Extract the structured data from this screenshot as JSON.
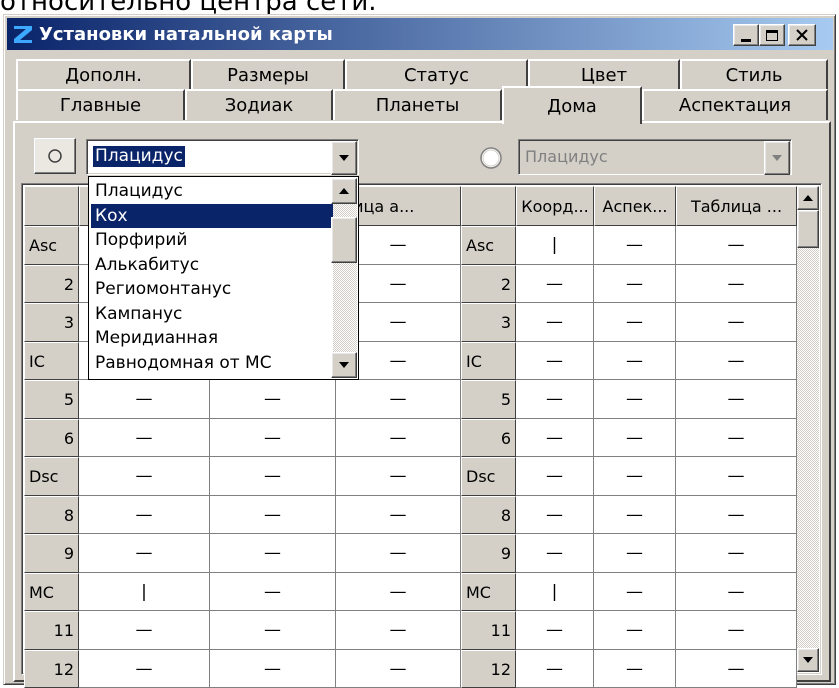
{
  "background_text": "относительно центра сети.",
  "window": {
    "title": "Установки натальной карты",
    "title_bar_color": "#0a246a",
    "title_bar_gradient_end": "#a6caf0",
    "face_color": "#d4d0c8",
    "selection_color": "#0a246a"
  },
  "tabs": {
    "row_back": [
      "Дополн.",
      "Размеры",
      "Статус",
      "Цвет",
      "Стиль"
    ],
    "row_front": [
      "Главные",
      "Зодиак",
      "Планеты",
      "Дома",
      "Аспектация"
    ],
    "active": "Дома"
  },
  "left_panel": {
    "house_system_value": "Плацидус",
    "column_headers": [
      "",
      "",
      "",
      "блица а..."
    ],
    "dropdown_options": [
      "Плацидус",
      "Кох",
      "Порфирий",
      "Алькабитус",
      "Региомонтанус",
      "Кампанус",
      "Меридианная",
      "Равнодомная от МС"
    ],
    "highlighted_option": "Кох"
  },
  "right_panel": {
    "house_system_value": "Плацидус",
    "column_headers": [
      "",
      "Коорд...",
      "Аспек...",
      "Таблица ..."
    ]
  },
  "rows": [
    {
      "house": "Asc",
      "left": [
        "",
        "—",
        "—"
      ],
      "right": [
        "|",
        "—",
        "—"
      ]
    },
    {
      "house": "2",
      "left": [
        "",
        "—",
        "—"
      ],
      "right": [
        "—",
        "—",
        "—"
      ]
    },
    {
      "house": "3",
      "left": [
        "",
        "—",
        "—"
      ],
      "right": [
        "—",
        "—",
        "—"
      ]
    },
    {
      "house": "IC",
      "left": [
        "",
        "—",
        "—"
      ],
      "right": [
        "—",
        "—",
        "—"
      ]
    },
    {
      "house": "5",
      "left": [
        "—",
        "—",
        "—"
      ],
      "right": [
        "—",
        "—",
        "—"
      ]
    },
    {
      "house": "6",
      "left": [
        "—",
        "—",
        "—"
      ],
      "right": [
        "—",
        "—",
        "—"
      ]
    },
    {
      "house": "Dsc",
      "left": [
        "—",
        "—",
        "—"
      ],
      "right": [
        "—",
        "—",
        "—"
      ]
    },
    {
      "house": "8",
      "left": [
        "—",
        "—",
        "—"
      ],
      "right": [
        "—",
        "—",
        "—"
      ]
    },
    {
      "house": "9",
      "left": [
        "—",
        "—",
        "—"
      ],
      "right": [
        "—",
        "—",
        "—"
      ]
    },
    {
      "house": "MC",
      "left": [
        "|",
        "—",
        "—"
      ],
      "right": [
        "|",
        "—",
        "—"
      ]
    },
    {
      "house": "11",
      "left": [
        "—",
        "—",
        "—"
      ],
      "right": [
        "—",
        "—",
        "—"
      ]
    },
    {
      "house": "12",
      "left": [
        "—",
        "—",
        "—"
      ],
      "right": [
        "—",
        "—",
        "—"
      ]
    }
  ],
  "icons": {
    "app": "z-logo-icon",
    "minimize": "minimize-icon",
    "maximize": "maximize-icon",
    "close": "close-icon",
    "radio": "radio-button-icon",
    "dropdown": "dropdown-arrow-icon",
    "scroll_up": "scroll-up-arrow-icon",
    "scroll_down": "scroll-down-arrow-icon"
  }
}
